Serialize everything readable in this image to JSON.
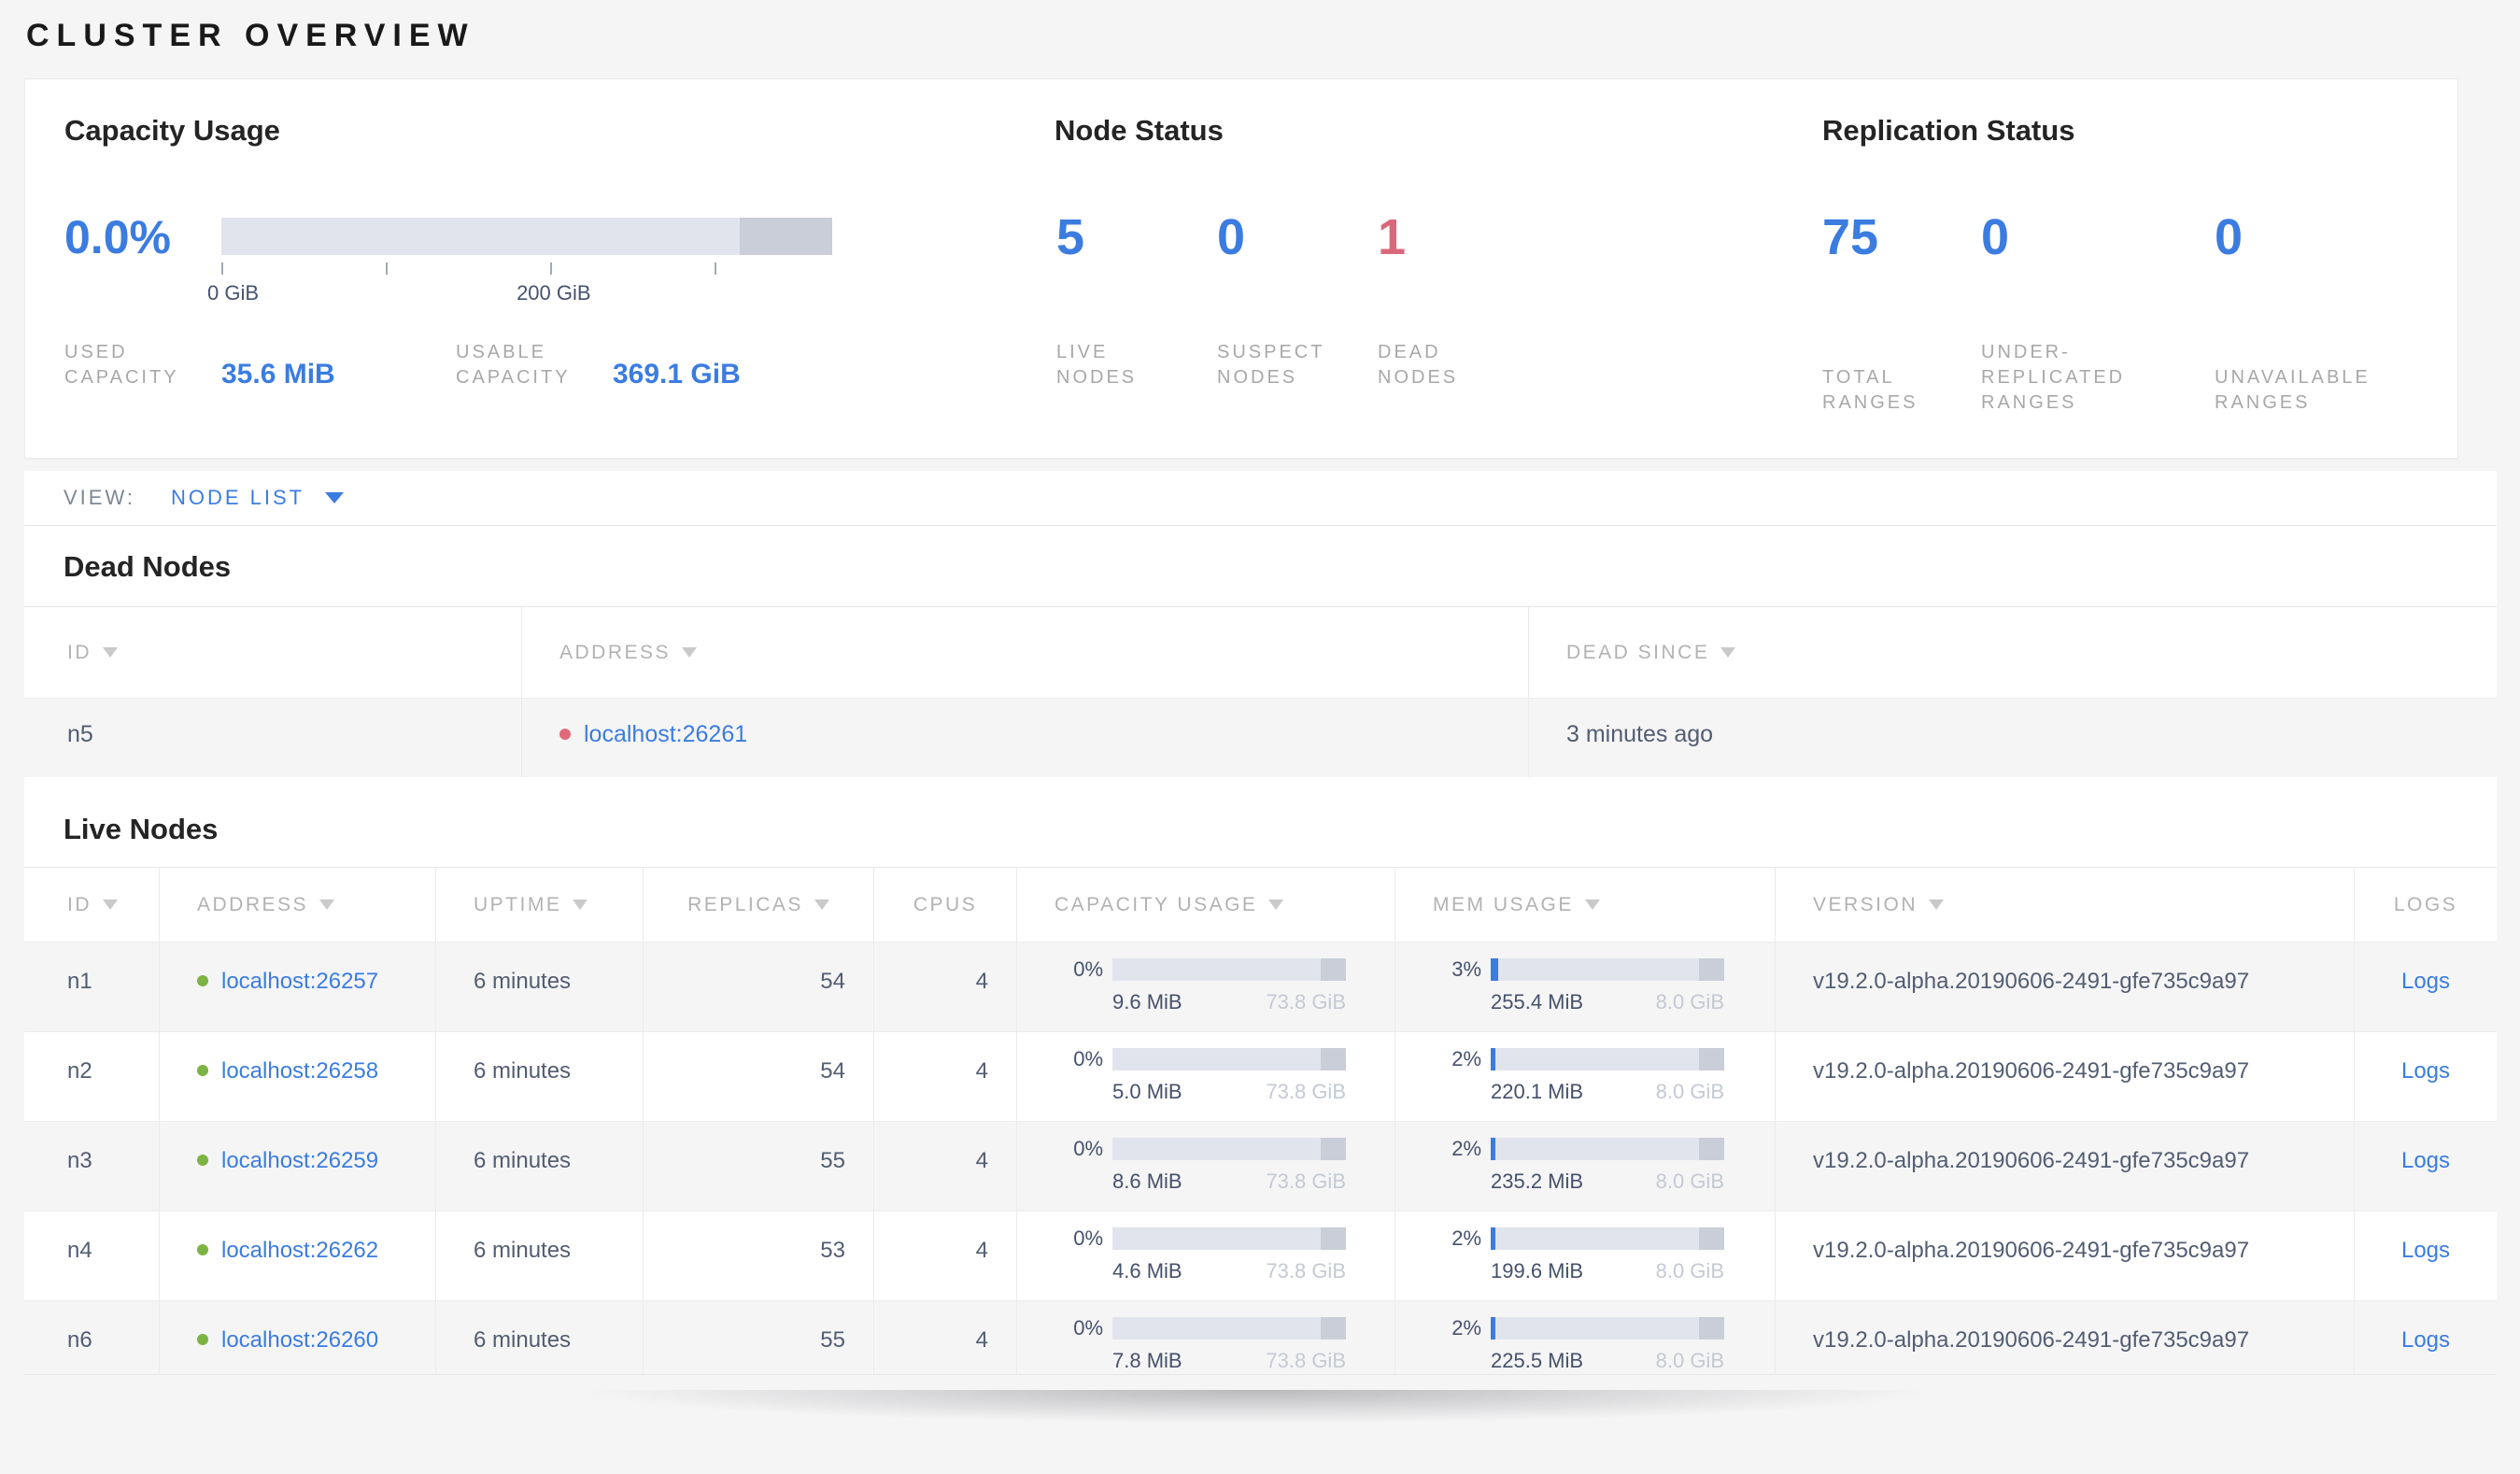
{
  "page_title": "CLUSTER OVERVIEW",
  "colors": {
    "accent_blue": "#3b7ce0",
    "dead_rose": "#d9697a",
    "live_green": "#7cb342"
  },
  "capacity": {
    "title": "Capacity Usage",
    "percent": "0.0%",
    "percent_value": 0,
    "ticks": [
      "0 GiB",
      "200 GiB"
    ],
    "stats": [
      {
        "label_lines": [
          "USED",
          "CAPACITY"
        ],
        "value": "35.6 MiB"
      },
      {
        "label_lines": [
          "USABLE",
          "CAPACITY"
        ],
        "value": "369.1 GiB"
      }
    ]
  },
  "node_status": {
    "title": "Node Status",
    "stats": [
      {
        "value": "5",
        "label_lines": [
          "LIVE",
          "NODES"
        ],
        "color": "#3b7ce0"
      },
      {
        "value": "0",
        "label_lines": [
          "SUSPECT",
          "NODES"
        ],
        "color": "#3b7ce0"
      },
      {
        "value": "1",
        "label_lines": [
          "DEAD",
          "NODES"
        ],
        "color": "#d9697a"
      }
    ]
  },
  "replication": {
    "title": "Replication Status",
    "stats": [
      {
        "value": "75",
        "label_lines": [
          "TOTAL",
          "RANGES"
        ],
        "color": "#3b7ce0"
      },
      {
        "value": "0",
        "label_lines": [
          "UNDER-",
          "REPLICATED",
          "RANGES"
        ],
        "color": "#3b7ce0"
      },
      {
        "value": "0",
        "label_lines": [
          "UNAVAILABLE",
          "RANGES"
        ],
        "color": "#3b7ce0"
      }
    ]
  },
  "view_bar": {
    "label": "VIEW:",
    "selected": "NODE LIST"
  },
  "dead_nodes": {
    "heading": "Dead Nodes",
    "columns": [
      {
        "label": "ID",
        "sortable": true
      },
      {
        "label": "ADDRESS",
        "sortable": true
      },
      {
        "label": "DEAD SINCE",
        "sortable": true
      }
    ],
    "rows": [
      {
        "id": "n5",
        "address": "localhost:26261",
        "dead_since": "3 minutes ago"
      }
    ]
  },
  "live_nodes": {
    "heading": "Live Nodes",
    "columns": [
      {
        "label": "ID",
        "sortable": true
      },
      {
        "label": "ADDRESS",
        "sortable": true
      },
      {
        "label": "UPTIME",
        "sortable": true
      },
      {
        "label": "REPLICAS",
        "sortable": true
      },
      {
        "label": "CPUS",
        "sortable": false
      },
      {
        "label": "CAPACITY USAGE",
        "sortable": true
      },
      {
        "label": "MEM USAGE",
        "sortable": true
      },
      {
        "label": "VERSION",
        "sortable": true
      },
      {
        "label": "LOGS",
        "sortable": false
      }
    ],
    "rows": [
      {
        "id": "n1",
        "address": "localhost:26257",
        "uptime": "6 minutes",
        "replicas": "54",
        "cpus": "4",
        "capacity": {
          "percent": "0%",
          "percent_value": 0,
          "used": "9.6 MiB",
          "total": "73.8 GiB"
        },
        "memory": {
          "percent": "3%",
          "percent_value": 3,
          "used": "255.4 MiB",
          "total": "8.0 GiB"
        },
        "version": "v19.2.0-alpha.20190606-2491-gfe735c9a97",
        "logs_label": "Logs"
      },
      {
        "id": "n2",
        "address": "localhost:26258",
        "uptime": "6 minutes",
        "replicas": "54",
        "cpus": "4",
        "capacity": {
          "percent": "0%",
          "percent_value": 0,
          "used": "5.0 MiB",
          "total": "73.8 GiB"
        },
        "memory": {
          "percent": "2%",
          "percent_value": 2,
          "used": "220.1 MiB",
          "total": "8.0 GiB"
        },
        "version": "v19.2.0-alpha.20190606-2491-gfe735c9a97",
        "logs_label": "Logs"
      },
      {
        "id": "n3",
        "address": "localhost:26259",
        "uptime": "6 minutes",
        "replicas": "55",
        "cpus": "4",
        "capacity": {
          "percent": "0%",
          "percent_value": 0,
          "used": "8.6 MiB",
          "total": "73.8 GiB"
        },
        "memory": {
          "percent": "2%",
          "percent_value": 2,
          "used": "235.2 MiB",
          "total": "8.0 GiB"
        },
        "version": "v19.2.0-alpha.20190606-2491-gfe735c9a97",
        "logs_label": "Logs"
      },
      {
        "id": "n4",
        "address": "localhost:26262",
        "uptime": "6 minutes",
        "replicas": "53",
        "cpus": "4",
        "capacity": {
          "percent": "0%",
          "percent_value": 0,
          "used": "4.6 MiB",
          "total": "73.8 GiB"
        },
        "memory": {
          "percent": "2%",
          "percent_value": 2,
          "used": "199.6 MiB",
          "total": "8.0 GiB"
        },
        "version": "v19.2.0-alpha.20190606-2491-gfe735c9a97",
        "logs_label": "Logs"
      },
      {
        "id": "n6",
        "address": "localhost:26260",
        "uptime": "6 minutes",
        "replicas": "55",
        "cpus": "4",
        "capacity": {
          "percent": "0%",
          "percent_value": 0,
          "used": "7.8 MiB",
          "total": "73.8 GiB"
        },
        "memory": {
          "percent": "2%",
          "percent_value": 2,
          "used": "225.5 MiB",
          "total": "8.0 GiB"
        },
        "version": "v19.2.0-alpha.20190606-2491-gfe735c9a97",
        "logs_label": "Logs"
      }
    ]
  }
}
